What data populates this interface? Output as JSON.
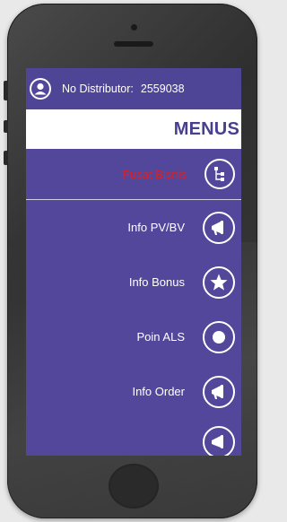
{
  "header": {
    "distributor_label": "No Distributor:",
    "distributor_number": "2559038"
  },
  "menu": {
    "title": "MENUS",
    "items": [
      {
        "label": "Pusat Bisnis",
        "icon": "network-icon",
        "active": true
      },
      {
        "label": "Info PV/BV",
        "icon": "megaphone-icon"
      },
      {
        "label": "Info Bonus",
        "icon": "star-icon"
      },
      {
        "label": "Poin ALS",
        "icon": "dot-icon"
      },
      {
        "label": "Info Order",
        "icon": "megaphone-icon"
      }
    ]
  },
  "colors": {
    "screen_bg": "#52479b",
    "header_text": "#483f8f",
    "active_label": "#d8222b"
  }
}
